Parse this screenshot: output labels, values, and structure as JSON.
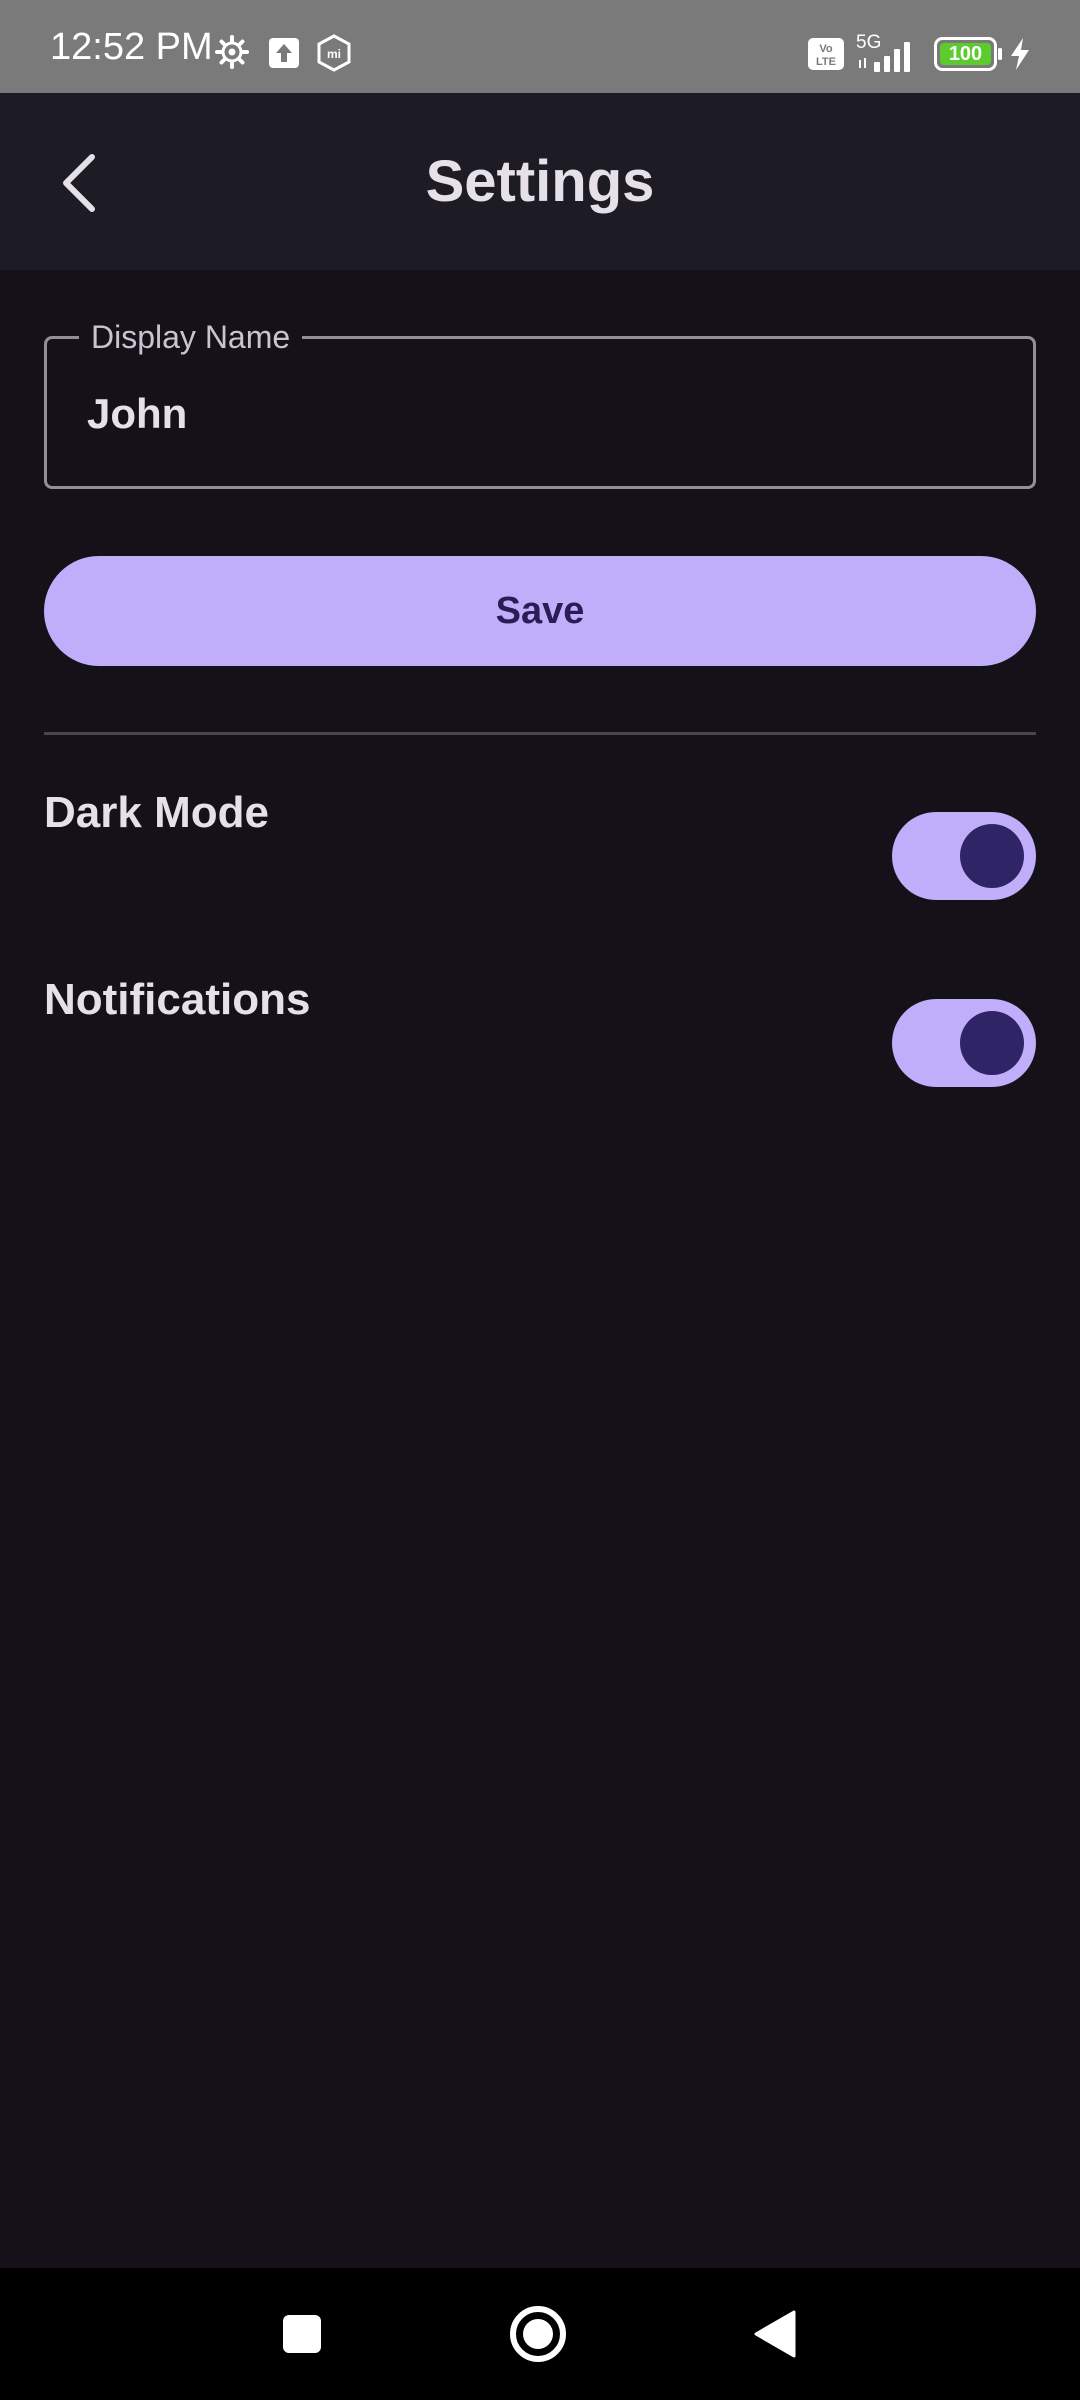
{
  "status_bar": {
    "time": "12:52 PM",
    "network": "5G",
    "volte": "Vo LTE",
    "battery": "100",
    "icons": [
      "settings-gear-icon",
      "upload-icon",
      "mi-icon",
      "volte-icon",
      "signal-icon",
      "battery-icon",
      "charging-icon"
    ]
  },
  "app_bar": {
    "title": "Settings",
    "back_icon": "chevron-left-icon"
  },
  "display_name": {
    "label": "Display Name",
    "value": "John"
  },
  "save_button": {
    "label": "Save"
  },
  "settings": [
    {
      "label": "Dark Mode",
      "enabled": true
    },
    {
      "label": "Notifications",
      "enabled": true
    }
  ],
  "nav_bar": {
    "icons": [
      "recents-square-icon",
      "home-circle-icon",
      "back-triangle-icon"
    ]
  },
  "colors": {
    "background": "#141218",
    "app_bar": "#1d1b24",
    "accent": "#c1aefa",
    "on_accent": "#2a1d55",
    "toggle_knob": "#2f2466",
    "battery_fill": "#5ccb2e"
  }
}
